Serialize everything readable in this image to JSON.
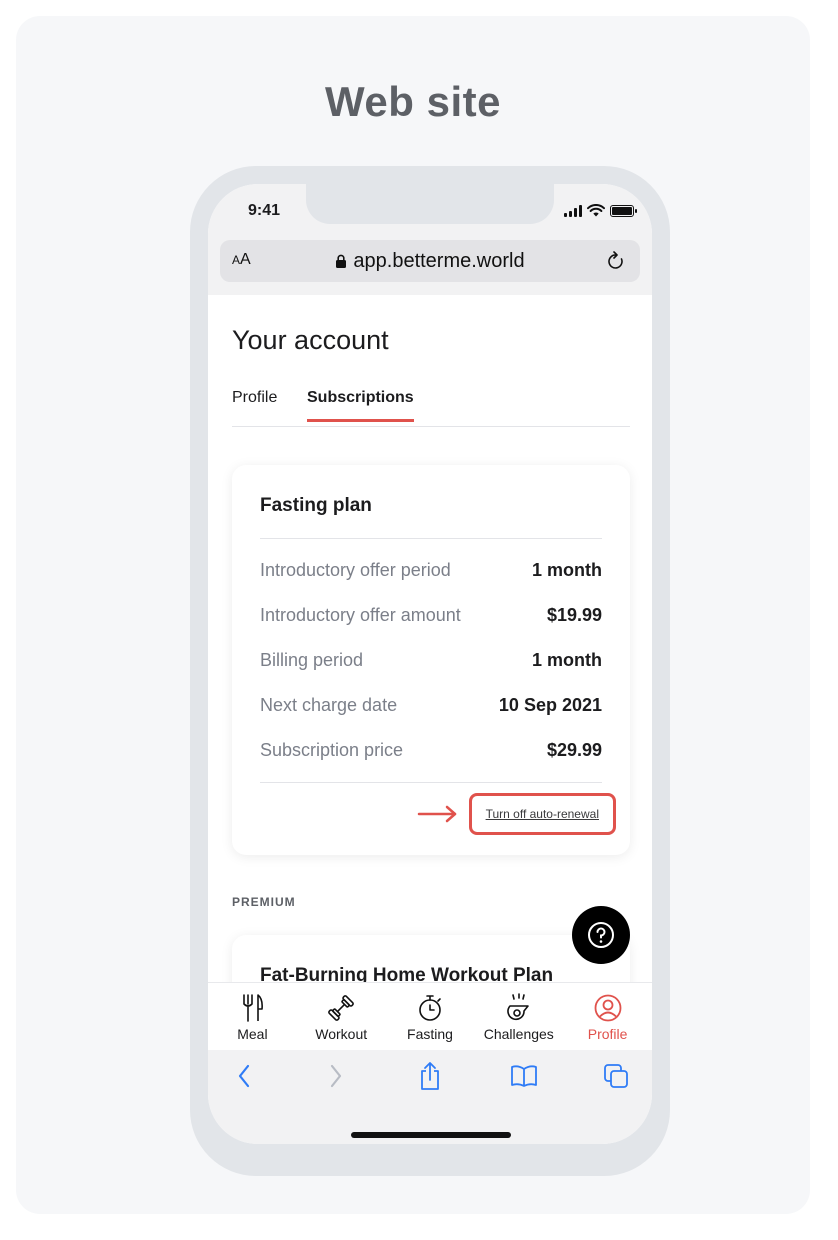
{
  "page": {
    "heading": "Web site"
  },
  "status_bar": {
    "time": "9:41"
  },
  "browser": {
    "text_size_label": "AA",
    "url": "app.betterme.world"
  },
  "account": {
    "title": "Your account",
    "tabs": [
      {
        "label": "Profile",
        "active": false
      },
      {
        "label": "Subscriptions",
        "active": true
      }
    ]
  },
  "plan": {
    "title": "Fasting plan",
    "rows": [
      {
        "label": "Introductory offer period",
        "value": "1 month"
      },
      {
        "label": "Introductory offer amount",
        "value": "$19.99"
      },
      {
        "label": "Billing period",
        "value": "1 month"
      },
      {
        "label": "Next charge date",
        "value": "10 Sep 2021"
      },
      {
        "label": "Subscription price",
        "value": "$29.99"
      }
    ],
    "auto_renewal_link": "Turn off auto-renewal"
  },
  "premium": {
    "section_label": "PREMIUM",
    "card_title": "Fat-Burning Home Workout Plan"
  },
  "app_nav": [
    {
      "label": "Meal",
      "icon": "fork-knife-icon",
      "active": false
    },
    {
      "label": "Workout",
      "icon": "dumbbell-icon",
      "active": false
    },
    {
      "label": "Fasting",
      "icon": "stopwatch-icon",
      "active": false
    },
    {
      "label": "Challenges",
      "icon": "whistle-icon",
      "active": false
    },
    {
      "label": "Profile",
      "icon": "profile-icon",
      "active": true
    }
  ],
  "colors": {
    "accent": "#e0524c",
    "text": "#1c1c1e",
    "muted": "#7b7f89",
    "safari_blue": "#2f7cf6"
  }
}
